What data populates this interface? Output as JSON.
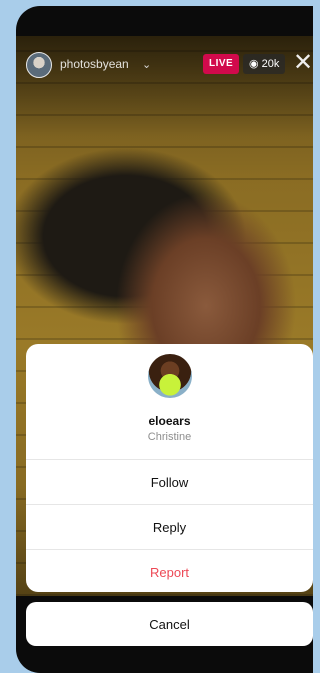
{
  "header": {
    "host_username": "photosbyean",
    "live_label": "LIVE",
    "viewer_count": "20k"
  },
  "sheet": {
    "username": "eloears",
    "full_name": "Christine",
    "actions": {
      "follow": "Follow",
      "reply": "Reply",
      "report": "Report"
    }
  },
  "cancel_label": "Cancel",
  "colors": {
    "live_badge": "#d10a4c",
    "report_text": "#ed4956",
    "page_background": "#a9cdea"
  },
  "icons": [
    "chevron-down-icon",
    "eye-icon",
    "close-icon"
  ]
}
